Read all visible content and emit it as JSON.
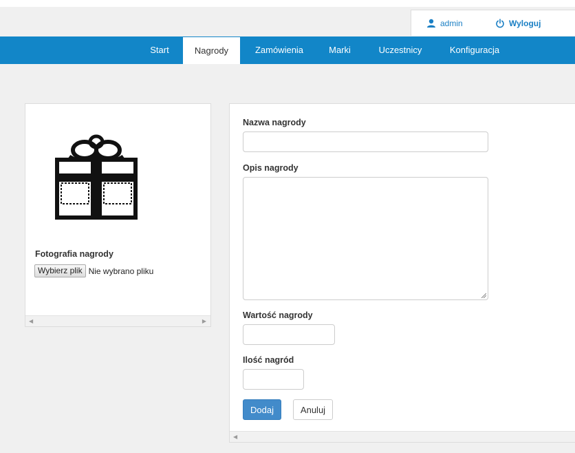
{
  "header": {
    "user_label": "admin",
    "logout_label": "Wyloguj"
  },
  "nav": {
    "items": [
      {
        "label": "Start"
      },
      {
        "label": "Nagrody"
      },
      {
        "label": "Zamówienia"
      },
      {
        "label": "Marki"
      },
      {
        "label": "Uczestnicy"
      },
      {
        "label": "Konfiguracja"
      }
    ],
    "active": "Nagrody"
  },
  "photo_panel": {
    "label": "Fotografia nagrody",
    "file_button": "Wybierz plik",
    "file_status": "Nie wybrano pliku",
    "image_icon": "gift-icon"
  },
  "form": {
    "name_label": "Nazwa nagrody",
    "name_value": "",
    "desc_label": "Opis nagrody",
    "desc_value": "",
    "value_label": "Wartość nagrody",
    "value_value": "",
    "qty_label": "Ilość nagród",
    "qty_value": "",
    "submit_label": "Dodaj",
    "cancel_label": "Anuluj"
  },
  "colors": {
    "nav_bg": "#1286c8",
    "link": "#1a7fc4",
    "primary": "#428bca"
  }
}
